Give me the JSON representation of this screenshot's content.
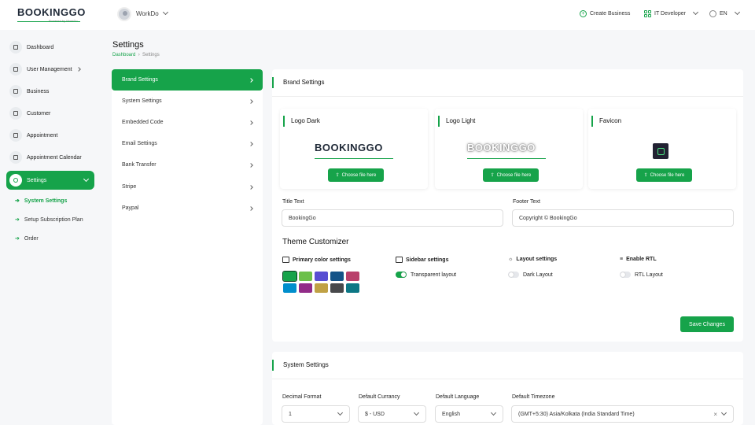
{
  "header": {
    "logo": "BOOKINGGO",
    "logo_sub": "Powered by WorkDo",
    "workspace": "WorkDo",
    "create_business": "Create Business",
    "role": "IT Developer",
    "language": "EN"
  },
  "sidebar": {
    "items": [
      {
        "label": "Dashboard",
        "icon": "home-icon"
      },
      {
        "label": "User Management",
        "icon": "users-icon"
      },
      {
        "label": "Business",
        "icon": "briefcase-icon"
      },
      {
        "label": "Customer",
        "icon": "user-icon"
      },
      {
        "label": "Appointment",
        "icon": "calendar-icon"
      },
      {
        "label": "Appointment Calendar",
        "icon": "calendar-icon"
      },
      {
        "label": "Settings",
        "icon": "gear-icon"
      }
    ],
    "sub_items": [
      "System Settings",
      "Setup Subscription Plan",
      "Order"
    ]
  },
  "page": {
    "title": "Settings",
    "breadcrumb_home": "Dashboard",
    "breadcrumb_current": "Settings"
  },
  "settings_menu": [
    "Brand Settings",
    "System Settings",
    "Embedded Code",
    "Email Settings",
    "Bank Transfer",
    "Stripe",
    "Paypal"
  ],
  "brand": {
    "title": "Brand Settings",
    "logo_dark": "Logo Dark",
    "logo_light": "Logo Light",
    "favicon": "Favicon",
    "choose_file": "Choose file here",
    "title_text_label": "Title Text",
    "title_text_value": "BookingGo",
    "footer_text_label": "Footer Text",
    "footer_text_value": "Copyright © BookingGo",
    "theme_title": "Theme Customizer",
    "primary_color_label": "Primary color settings",
    "sidebar_settings_label": "Sidebar settings",
    "layout_settings_label": "Layout settings",
    "enable_rtl_label": "Enable RTL",
    "transparent_layout": "Transparent layout",
    "dark_layout": "Dark Layout",
    "rtl_layout": "RTL Layout",
    "save_button": "Save Changes",
    "colors": [
      "#16a34a",
      "#6cc04a",
      "#584ed2",
      "#145388",
      "#b9406b",
      "#008ecc",
      "#922c88",
      "#c0a145",
      "#48494b",
      "#0c7785"
    ],
    "toggles": {
      "transparent_layout": true,
      "dark_layout": false,
      "rtl_layout": false
    }
  },
  "system": {
    "title": "System Settings",
    "decimal_label": "Decimal Format",
    "decimal_value": "1",
    "currency_label": "Default Currancy",
    "currency_value": "$ - USD",
    "language_label": "Default Language",
    "language_value": "English",
    "timezone_label": "Default Timezone",
    "timezone_value": "(GMT+5:30) Asia/Kolkata (India Standard Time)"
  }
}
